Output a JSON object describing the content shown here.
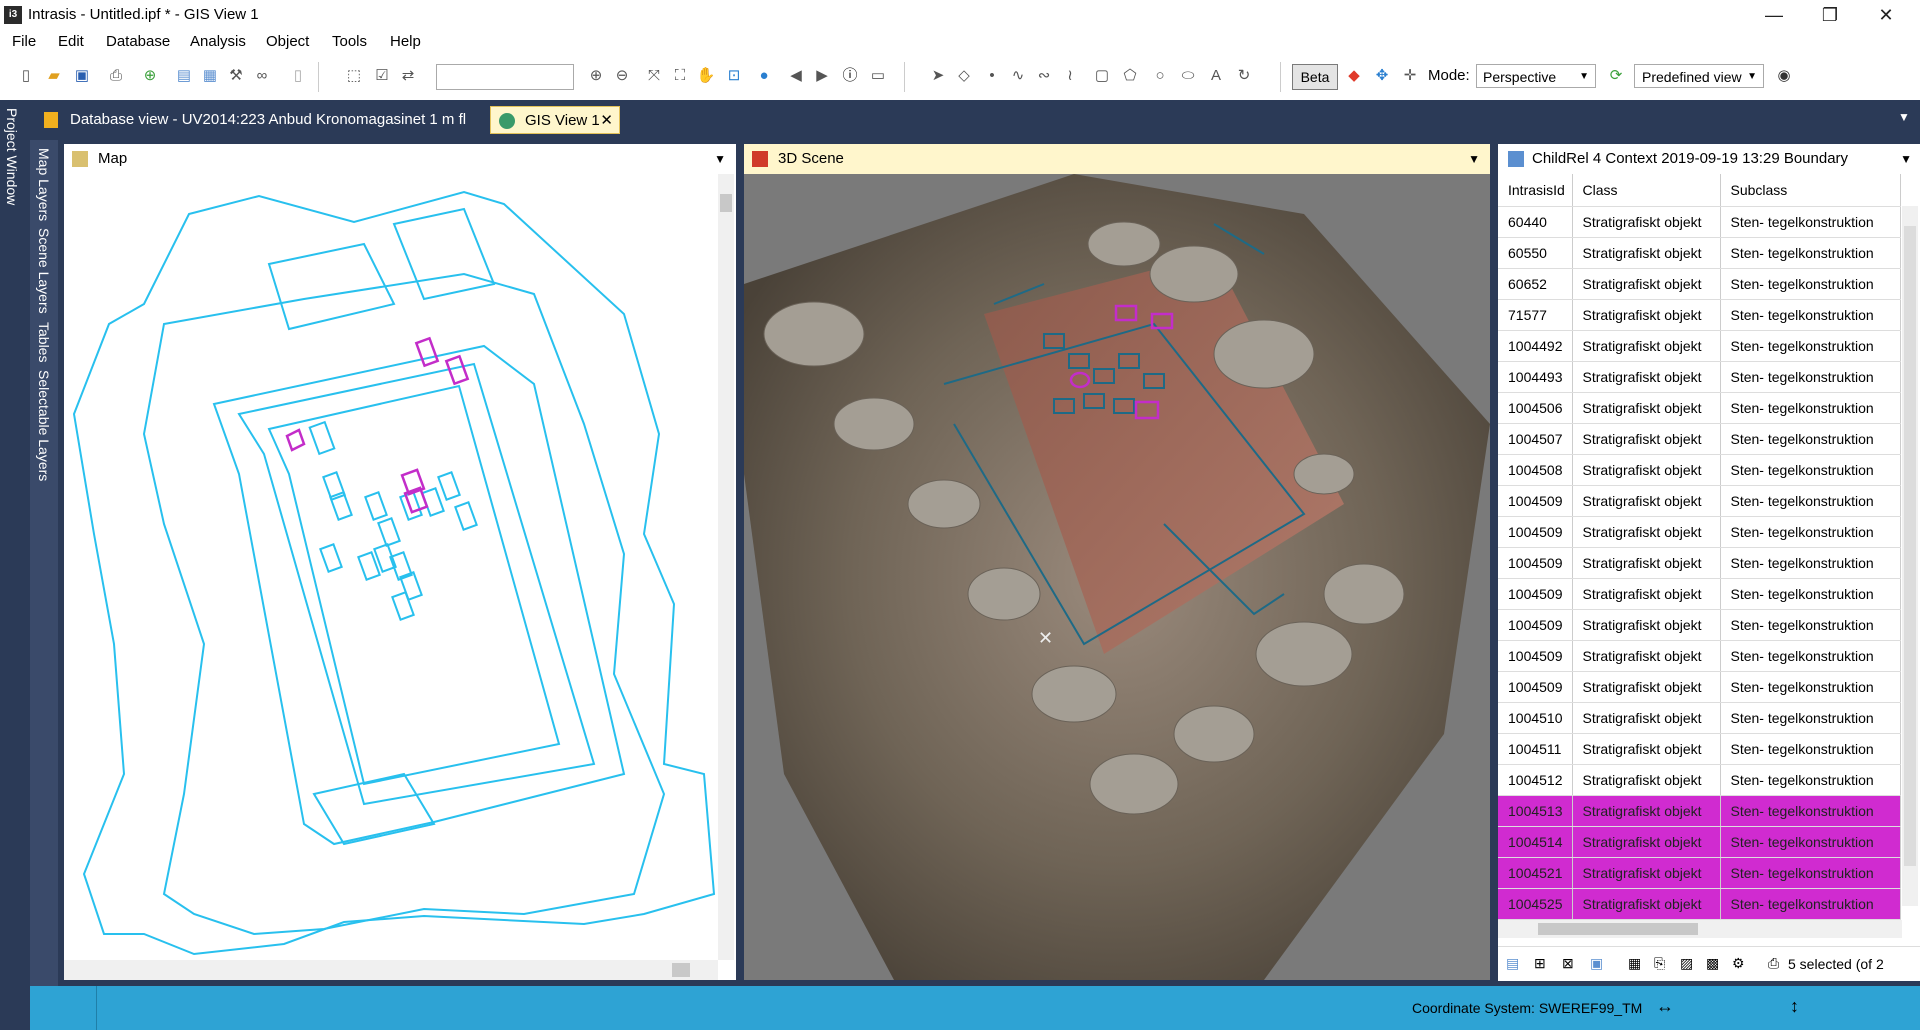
{
  "window": {
    "app_label": "i3",
    "title": "Intrasis - Untitled.ipf * - GIS View 1",
    "minimize": "—",
    "maximize": "❐",
    "close": "✕"
  },
  "menu": [
    "File",
    "Edit",
    "Database",
    "Analysis",
    "Object",
    "Tools",
    "Help"
  ],
  "toolbar": {
    "beta_label": "Beta",
    "mode_label": "Mode:",
    "mode_value": "Perspective",
    "predefined_view": "Predefined view",
    "search_value": ""
  },
  "doc_tabs": [
    {
      "label": "Database view - UV2014:223 Anbud Kronomagasinet 1 m fl",
      "active": false
    },
    {
      "label": "GIS View 1",
      "active": true
    }
  ],
  "side_tabs": {
    "project_window": "Project Window",
    "map_layers": "Map Layers",
    "scene_layers": "Scene Layers",
    "tables": "Tables",
    "selectable_layers": "Selectable Layers"
  },
  "panels": {
    "map": "Map",
    "scene": "3D Scene",
    "table": "ChildRel 4 Context 2019-09-19 13:29 Boundary"
  },
  "table": {
    "columns": [
      "IntrasisId",
      "Class",
      "Subclass"
    ],
    "rows": [
      [
        "60440",
        "Stratigrafiskt objekt",
        "Sten- tegelkonstruktion",
        false
      ],
      [
        "60550",
        "Stratigrafiskt objekt",
        "Sten- tegelkonstruktion",
        false
      ],
      [
        "60652",
        "Stratigrafiskt objekt",
        "Sten- tegelkonstruktion",
        false
      ],
      [
        "71577",
        "Stratigrafiskt objekt",
        "Sten- tegelkonstruktion",
        false
      ],
      [
        "1004492",
        "Stratigrafiskt objekt",
        "Sten- tegelkonstruktion",
        false
      ],
      [
        "1004493",
        "Stratigrafiskt objekt",
        "Sten- tegelkonstruktion",
        false
      ],
      [
        "1004506",
        "Stratigrafiskt objekt",
        "Sten- tegelkonstruktion",
        false
      ],
      [
        "1004507",
        "Stratigrafiskt objekt",
        "Sten- tegelkonstruktion",
        false
      ],
      [
        "1004508",
        "Stratigrafiskt objekt",
        "Sten- tegelkonstruktion",
        false
      ],
      [
        "1004509",
        "Stratigrafiskt objekt",
        "Sten- tegelkonstruktion",
        false
      ],
      [
        "1004509",
        "Stratigrafiskt objekt",
        "Sten- tegelkonstruktion",
        false
      ],
      [
        "1004509",
        "Stratigrafiskt objekt",
        "Sten- tegelkonstruktion",
        false
      ],
      [
        "1004509",
        "Stratigrafiskt objekt",
        "Sten- tegelkonstruktion",
        false
      ],
      [
        "1004509",
        "Stratigrafiskt objekt",
        "Sten- tegelkonstruktion",
        false
      ],
      [
        "1004509",
        "Stratigrafiskt objekt",
        "Sten- tegelkonstruktion",
        false
      ],
      [
        "1004509",
        "Stratigrafiskt objekt",
        "Sten- tegelkonstruktion",
        false
      ],
      [
        "1004510",
        "Stratigrafiskt objekt",
        "Sten- tegelkonstruktion",
        false
      ],
      [
        "1004511",
        "Stratigrafiskt objekt",
        "Sten- tegelkonstruktion",
        false
      ],
      [
        "1004512",
        "Stratigrafiskt objekt",
        "Sten- tegelkonstruktion",
        false
      ],
      [
        "1004513",
        "Stratigrafiskt objekt",
        "Sten- tegelkonstruktion",
        true
      ],
      [
        "1004514",
        "Stratigrafiskt objekt",
        "Sten- tegelkonstruktion",
        true
      ],
      [
        "1004521",
        "Stratigrafiskt objekt",
        "Sten- tegelkonstruktion",
        true
      ],
      [
        "1004525",
        "Stratigrafiskt objekt",
        "Sten- tegelkonstruktion",
        true
      ]
    ],
    "selection_status": "5 selected (of 2"
  },
  "status": {
    "coordinate_system": "Coordinate System: SWEREF99_TM"
  },
  "colors": {
    "accent": "#2ea3d4",
    "selection": "#d02bd0",
    "map_lines": "#28c0ee",
    "dark": "#2b3a57"
  }
}
